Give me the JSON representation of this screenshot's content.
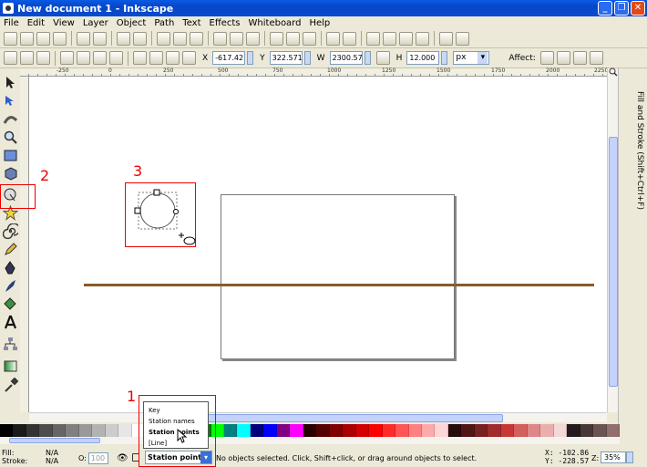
{
  "window": {
    "title": "New document 1 - Inkscape",
    "buttons": [
      "_",
      "❐",
      "✕"
    ]
  },
  "menu": [
    "File",
    "Edit",
    "View",
    "Layer",
    "Object",
    "Path",
    "Text",
    "Effects",
    "Whiteboard",
    "Help"
  ],
  "select_toolbar": {
    "x_label": "X",
    "x_value": "-617.42",
    "y_label": "Y",
    "y_value": "322.571",
    "w_label": "W",
    "w_value": "2300.57",
    "h_label": "H",
    "h_value": "12.000",
    "unit": "px",
    "affect_label": "Affect:"
  },
  "ruler": {
    "marks": [
      "-250",
      "0",
      "250",
      "500",
      "750",
      "1000",
      "1250",
      "1500",
      "1750",
      "2000",
      "2250"
    ]
  },
  "dock": {
    "dialog_label": "Fill and Stroke (Shift+Ctrl+F)"
  },
  "annotations": {
    "one": "1",
    "two": "2",
    "three": "3"
  },
  "layer_dropdown": {
    "options": [
      "Key",
      "Station names",
      "Station points",
      "[Line]"
    ],
    "selected": "Station points"
  },
  "statusbar": {
    "fill_label": "Fill:",
    "fill_value": "N/A",
    "stroke_label": "Stroke:",
    "stroke_value": "N/A",
    "opacity_label": "O:",
    "opacity_value": "100",
    "current_layer": "Station points",
    "message": "No objects selected. Click, Shift+click, or drag around objects to select.",
    "cursor_x": "X: -102.86",
    "cursor_y": "Y: -228.57",
    "zoom_label": "Z:",
    "zoom_value": "35%"
  },
  "palette_colors": [
    "#000000",
    "#1a1a1a",
    "#333333",
    "#4d4d4d",
    "#666666",
    "#808080",
    "#999999",
    "#b3b3b3",
    "#cccccc",
    "#e6e6e6",
    "#ffffff",
    "#800000",
    "#ff0000",
    "#808000",
    "#ffff00",
    "#008000",
    "#00ff00",
    "#008080",
    "#00ffff",
    "#000080",
    "#0000ff",
    "#800080",
    "#ff00ff",
    "#2b0000",
    "#550000",
    "#800000",
    "#aa0000",
    "#d40000",
    "#ff0000",
    "#ff2a2a",
    "#ff5555",
    "#ff8080",
    "#ffaaaa",
    "#ffd5d5",
    "#280b0b",
    "#501616",
    "#782121",
    "#a02c2c",
    "#c83737",
    "#d35f5f",
    "#de8787",
    "#e9afaf",
    "#f4d7d7",
    "#241c1c",
    "#483737",
    "#6c5353",
    "#916f6f"
  ]
}
